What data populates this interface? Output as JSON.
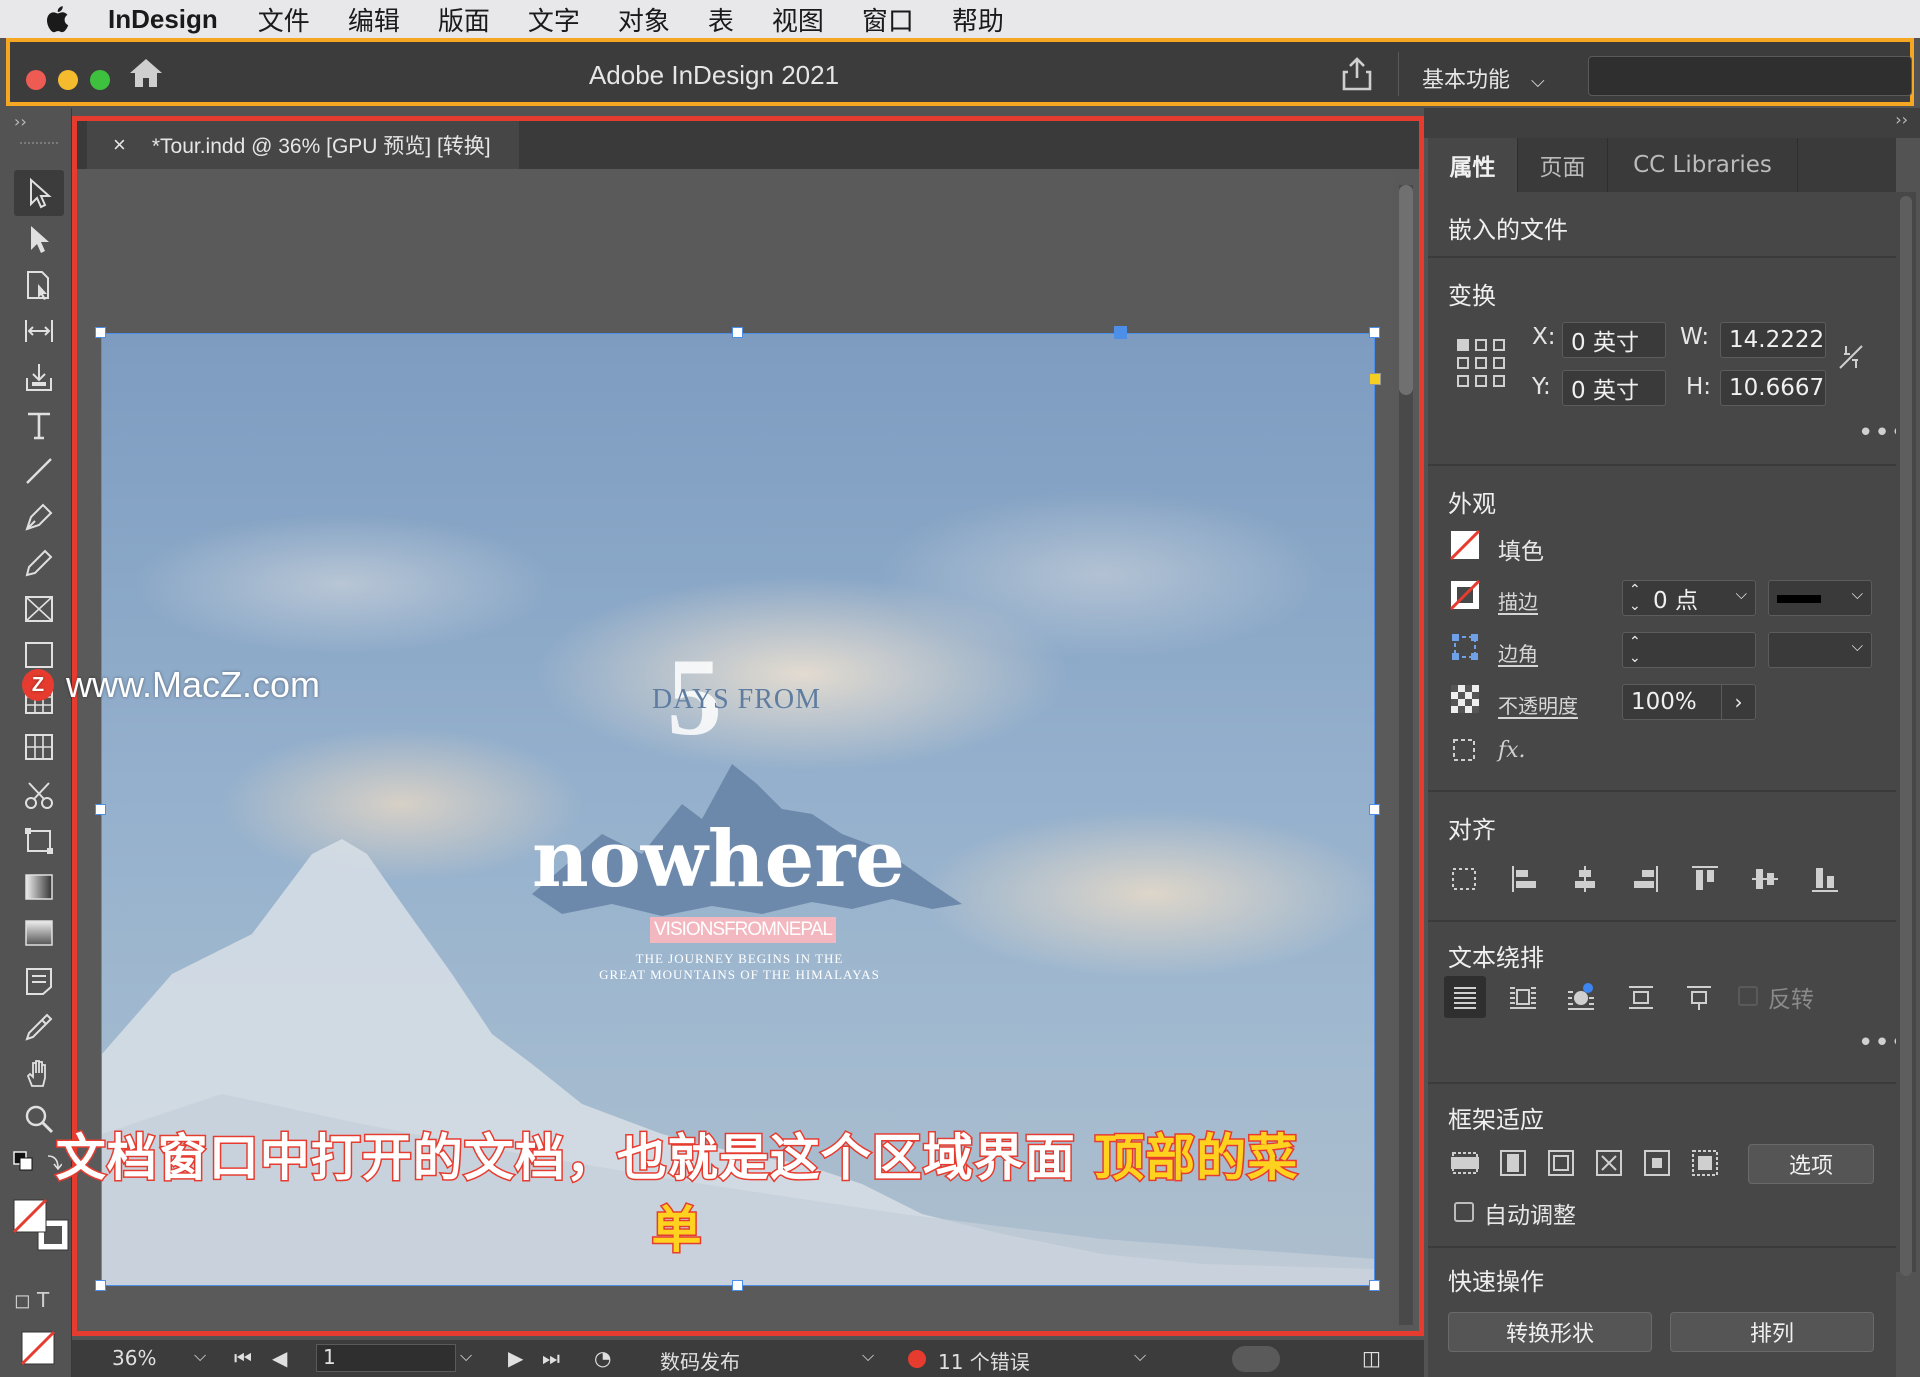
{
  "menubar": {
    "app": "InDesign",
    "items": [
      "文件",
      "编辑",
      "版面",
      "文字",
      "对象",
      "表",
      "视图",
      "窗口",
      "帮助"
    ]
  },
  "titlebar": {
    "title": "Adobe InDesign 2021",
    "workspace": "基本功能"
  },
  "document": {
    "tab_label": "*Tour.indd @ 36% [GPU 预览] [转换]",
    "poster": {
      "number": "5",
      "days_from": "DAYS FROM",
      "title": "nowhere",
      "tag": "VISIONSFROMNEPAL",
      "line1": "THE JOURNEY BEGINS IN THE",
      "line2": "GREAT MOUNTAINS OF THE HIMALAYAS"
    }
  },
  "watermark": {
    "text": "www.MacZ.com",
    "badge": "Z"
  },
  "caption": {
    "main": "文档窗口中打开的文档，也就是这个区域界面",
    "highlight": "顶部的菜单"
  },
  "statusbar": {
    "zoom": "36%",
    "page": "1",
    "preset": "数码发布",
    "errors": "11 个错误"
  },
  "panel": {
    "tabs": [
      "属性",
      "页面",
      "CC Libraries"
    ],
    "embedded": "嵌入的文件",
    "transform": {
      "title": "变换",
      "x_label": "X:",
      "x": "0 英寸",
      "y_label": "Y:",
      "y": "0 英寸",
      "w_label": "W:",
      "w": "14.2222",
      "h_label": "H:",
      "h": "10.6667"
    },
    "appearance": {
      "title": "外观",
      "fill": "填色",
      "stroke": "描边",
      "stroke_value": "0 点",
      "corner": "边角",
      "opacity": "不透明度",
      "opacity_value": "100%"
    },
    "align": {
      "title": "对齐"
    },
    "wrap": {
      "title": "文本绕排",
      "invert": "反转"
    },
    "fitting": {
      "title": "框架适应",
      "options": "选项",
      "auto": "自动调整"
    },
    "quick": {
      "title": "快速操作",
      "convert": "转换形状",
      "arrange": "排列"
    }
  },
  "colors": {
    "highlight_frame": "#f5a623",
    "doc_frame": "#e63c2f",
    "selection": "#4d8fe8"
  }
}
